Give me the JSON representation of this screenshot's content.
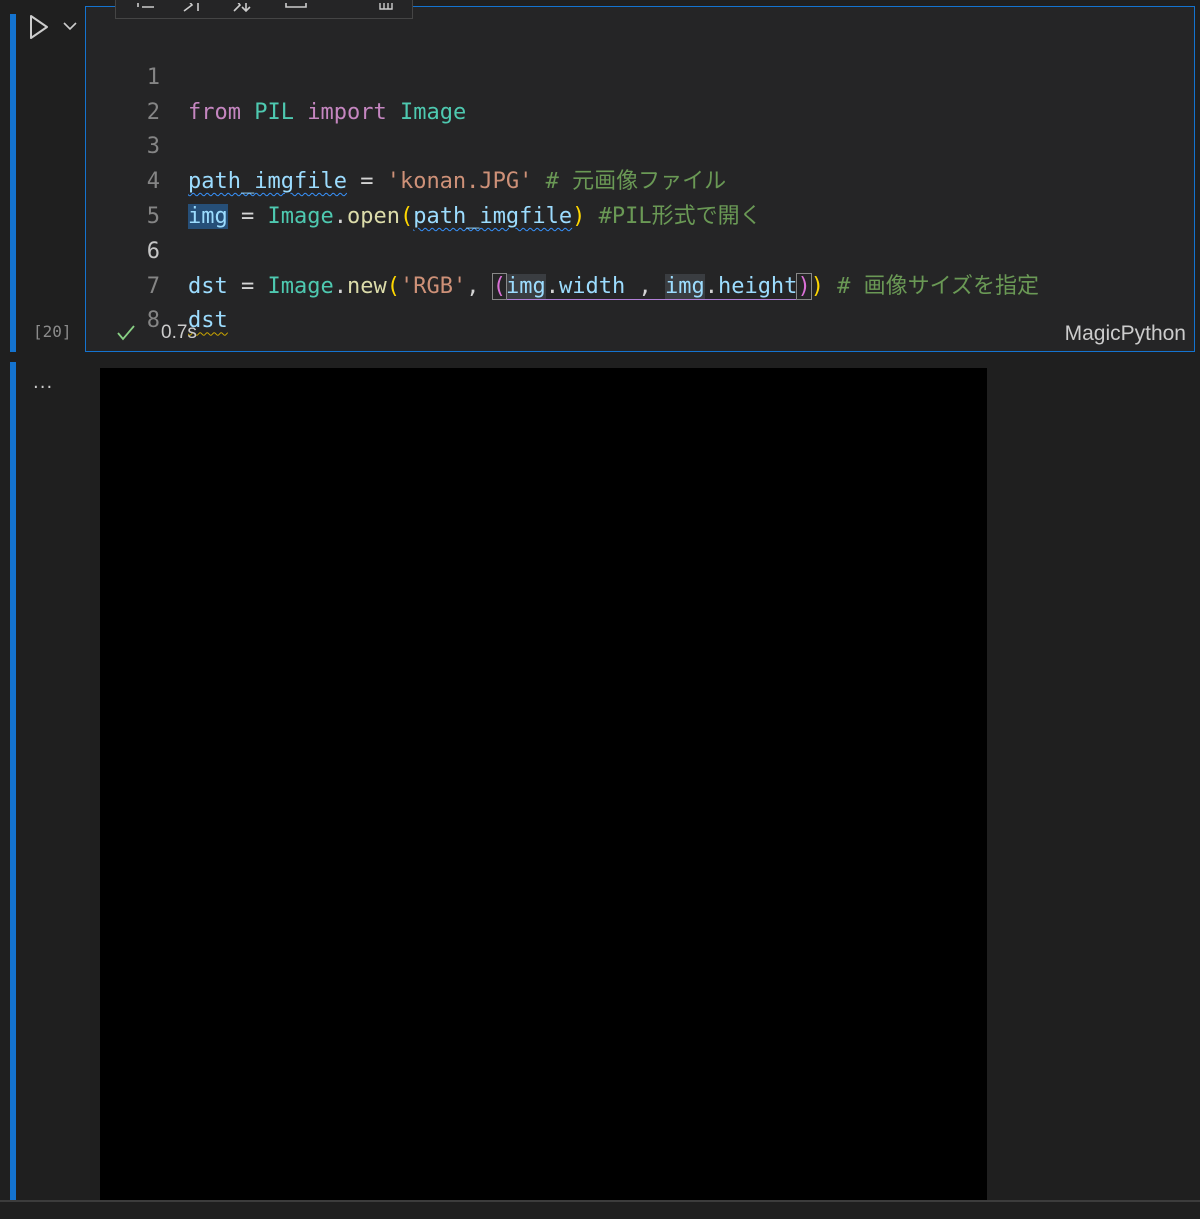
{
  "cell": {
    "execution_count": "[20]",
    "status": {
      "icon": "check-icon",
      "duration": "0.7s",
      "language": "MagicPython"
    },
    "lines": [
      {
        "number": "1"
      },
      {
        "number": "2"
      },
      {
        "number": "3"
      },
      {
        "number": "4"
      },
      {
        "number": "5"
      },
      {
        "number": "6"
      },
      {
        "number": "7"
      },
      {
        "number": "8"
      }
    ],
    "tokens": {
      "l1_from": "from",
      "l1_pil": "PIL",
      "l1_import": "import",
      "l1_image": "Image",
      "l3_var": "path_imgfile",
      "l3_eq": " = ",
      "l3_str": "'konan.JPG'",
      "l3_cmt": " # 元画像ファイル",
      "l4_img": "img",
      "l4_eq": " = ",
      "l4_image": "Image",
      "l4_dot": ".",
      "l4_open": "open",
      "l4_lp": "(",
      "l4_arg": "path_imgfile",
      "l4_rp": ")",
      "l4_cmt": " #PIL形式で開く",
      "l6_dst": "dst",
      "l6_eq": " = ",
      "l6_image": "Image",
      "l6_dot": ".",
      "l6_new": "new",
      "l6_lp": "(",
      "l6_str": "'RGB'",
      "l6_comma": ", ",
      "l6_lp2": "(",
      "l6_img1": "img",
      "l6_dot1": ".",
      "l6_width": "width",
      "l6_sep": " , ",
      "l6_img2": "img",
      "l6_dot2": ".",
      "l6_height": "height",
      "l6_rp2": ")",
      "l6_rp": ")",
      "l6_cmt": " # 画像サイズを指定",
      "l7_dst": "dst"
    }
  },
  "output": {
    "menu_icon": "ellipsis-icon",
    "menu_label": "...",
    "image_color": "#000000"
  },
  "toolbar": {
    "icons": [
      "run-by-line-icon",
      "execute-above-icon",
      "execute-below-icon",
      "split-cell-icon",
      "delete-icon"
    ]
  },
  "colors": {
    "accent": "#1473cf",
    "editor_bg": "#252526",
    "page_bg": "#1f1f1f",
    "check": "#89d185"
  }
}
